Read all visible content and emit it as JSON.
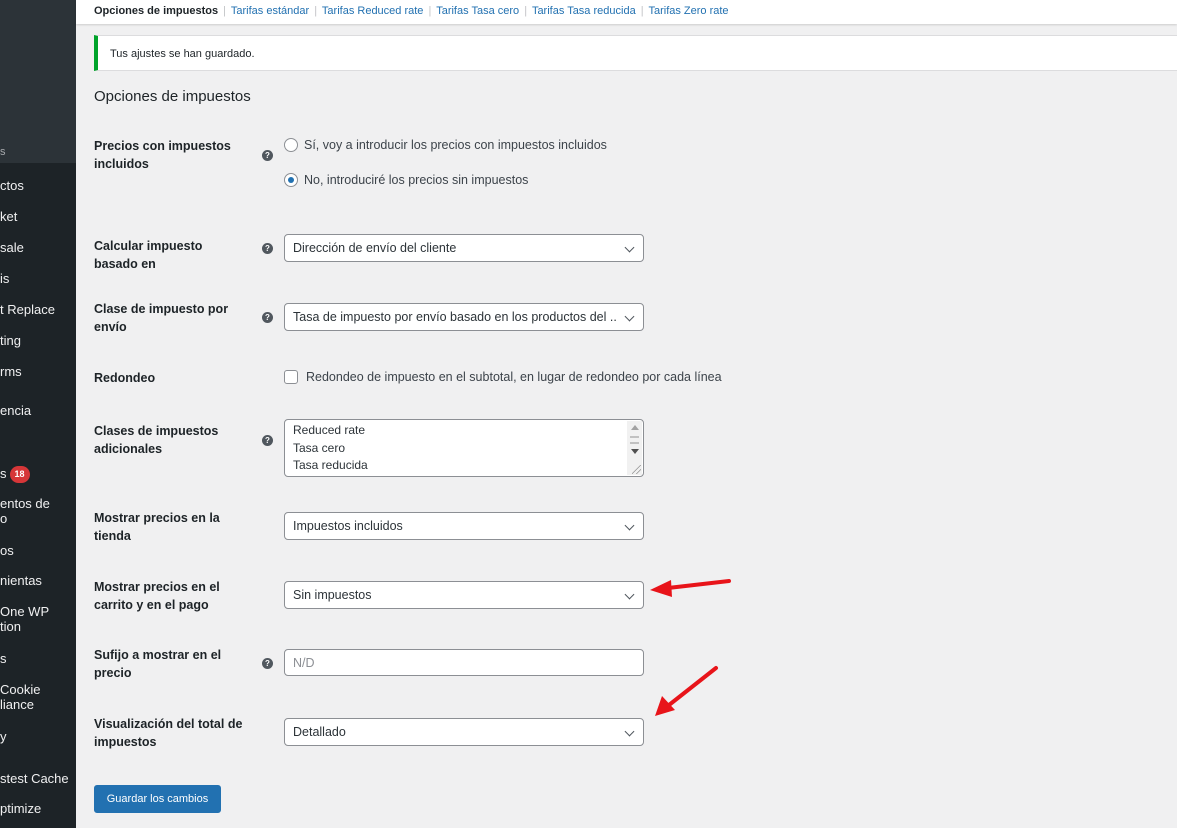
{
  "sidebar": {
    "section_label": "s",
    "items": [
      {
        "label": "ctos"
      },
      {
        "label": "ket"
      },
      {
        "label": "sale"
      },
      {
        "label": "is"
      },
      {
        "label": "t Replace"
      },
      {
        "label": "ting"
      },
      {
        "label": "rms"
      },
      {
        "label": "encia"
      },
      {
        "label": "s",
        "badge": "18"
      },
      {
        "label": "entos de",
        "label2": "o"
      },
      {
        "label": "os"
      },
      {
        "label": "nientas"
      },
      {
        "label": "One WP",
        "label2": "tion"
      },
      {
        "label": "s"
      },
      {
        "label": "Cookie",
        "label2": "liance"
      },
      {
        "label": "y"
      },
      {
        "label": "stest Cache"
      },
      {
        "label": "ptimize"
      }
    ]
  },
  "subnav": {
    "current": "Opciones de impuestos",
    "links": [
      "Tarifas estándar",
      "Tarifas Reduced rate",
      "Tarifas Tasa cero",
      "Tarifas Tasa reducida",
      "Tarifas Zero rate"
    ],
    "separator": "|"
  },
  "notice": {
    "text": "Tus ajustes se han guardado."
  },
  "page_title": "Opciones de impuestos",
  "fields": {
    "prices_include_tax": {
      "label": "Precios con impuestos incluidos",
      "options": [
        {
          "label": "Sí, voy a introducir los precios con impuestos incluidos",
          "checked": false
        },
        {
          "label": "No, introduciré los precios sin impuestos",
          "checked": true
        }
      ]
    },
    "tax_based_on": {
      "label": "Calcular impuesto basado en",
      "value": "Dirección de envío del cliente"
    },
    "shipping_tax_class": {
      "label": "Clase de impuesto por envío",
      "value": "Tasa de impuesto por envío basado en los productos del ..."
    },
    "rounding": {
      "label": "Redondeo",
      "checkbox_label": "Redondeo de impuesto en el subtotal, en lugar de redondeo por cada línea",
      "checked": false
    },
    "tax_classes": {
      "label": "Clases de impuestos adicionales",
      "lines": [
        "Reduced rate",
        "Tasa cero",
        "Tasa reducida"
      ]
    },
    "display_shop": {
      "label": "Mostrar precios en la tienda",
      "value": "Impuestos incluidos"
    },
    "display_cart": {
      "label": "Mostrar precios en el carrito y en el pago",
      "value": "Sin impuestos"
    },
    "price_suffix": {
      "label": "Sufijo a mostrar en el precio",
      "placeholder": "N/D",
      "value": ""
    },
    "tax_total_display": {
      "label": "Visualización del total de impuestos",
      "value": "Detallado"
    }
  },
  "help_icon_glyph": "?",
  "save_button": "Guardar los cambios",
  "colors": {
    "sidebar_bg": "#1d2327",
    "link": "#2271b1",
    "notice_border": "#00a32a",
    "primary_button": "#2271b1",
    "annotation_arrow": "#e8141a",
    "badge": "#d63638"
  }
}
